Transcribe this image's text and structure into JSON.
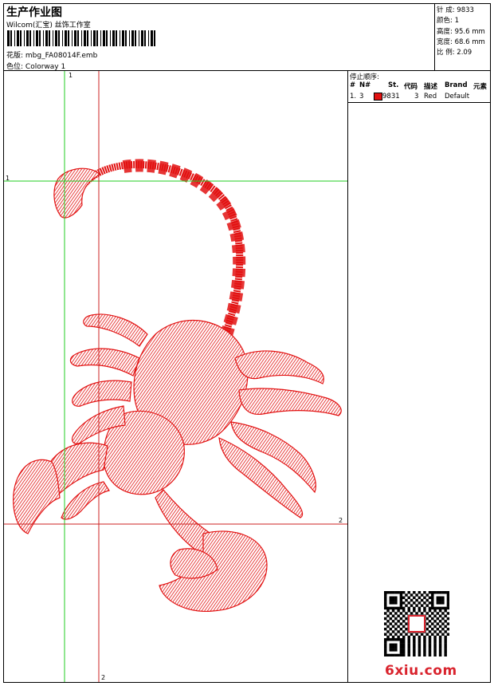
{
  "header": {
    "title": "生产作业图",
    "company": "Wilcom(汇宝) 丝饰工作室",
    "design_label": "花版: ",
    "design_file": "mbg_FA08014F.emb",
    "colorway_label": "色位: ",
    "colorway": "Colorway 1"
  },
  "stats": [
    {
      "label": "针 成:",
      "value": "9833"
    },
    {
      "label": "颜色:",
      "value": "1"
    },
    {
      "label": "高度:",
      "value": "95.6 mm"
    },
    {
      "label": "宽度:",
      "value": "68.6 mm"
    },
    {
      "label": "比 例:",
      "value": "2.09"
    }
  ],
  "guides": {
    "v1": "1",
    "h1": "1",
    "h2": "2",
    "v2": "2"
  },
  "stop_sequence": {
    "title": "停止顺序:",
    "columns": [
      "#",
      "N#",
      "St.",
      "代码",
      "描述",
      "Brand",
      "元素"
    ],
    "rows": [
      {
        "index": "1.",
        "needle": "3",
        "stitches": "9831",
        "code": "3",
        "desc": "Red",
        "brand": "Default",
        "color": "#e21212"
      }
    ]
  },
  "watermark": "6xiu.com",
  "colors": {
    "thread": "#e21212",
    "guide_green": "#22cc22",
    "guide_red": "#cc2222"
  }
}
